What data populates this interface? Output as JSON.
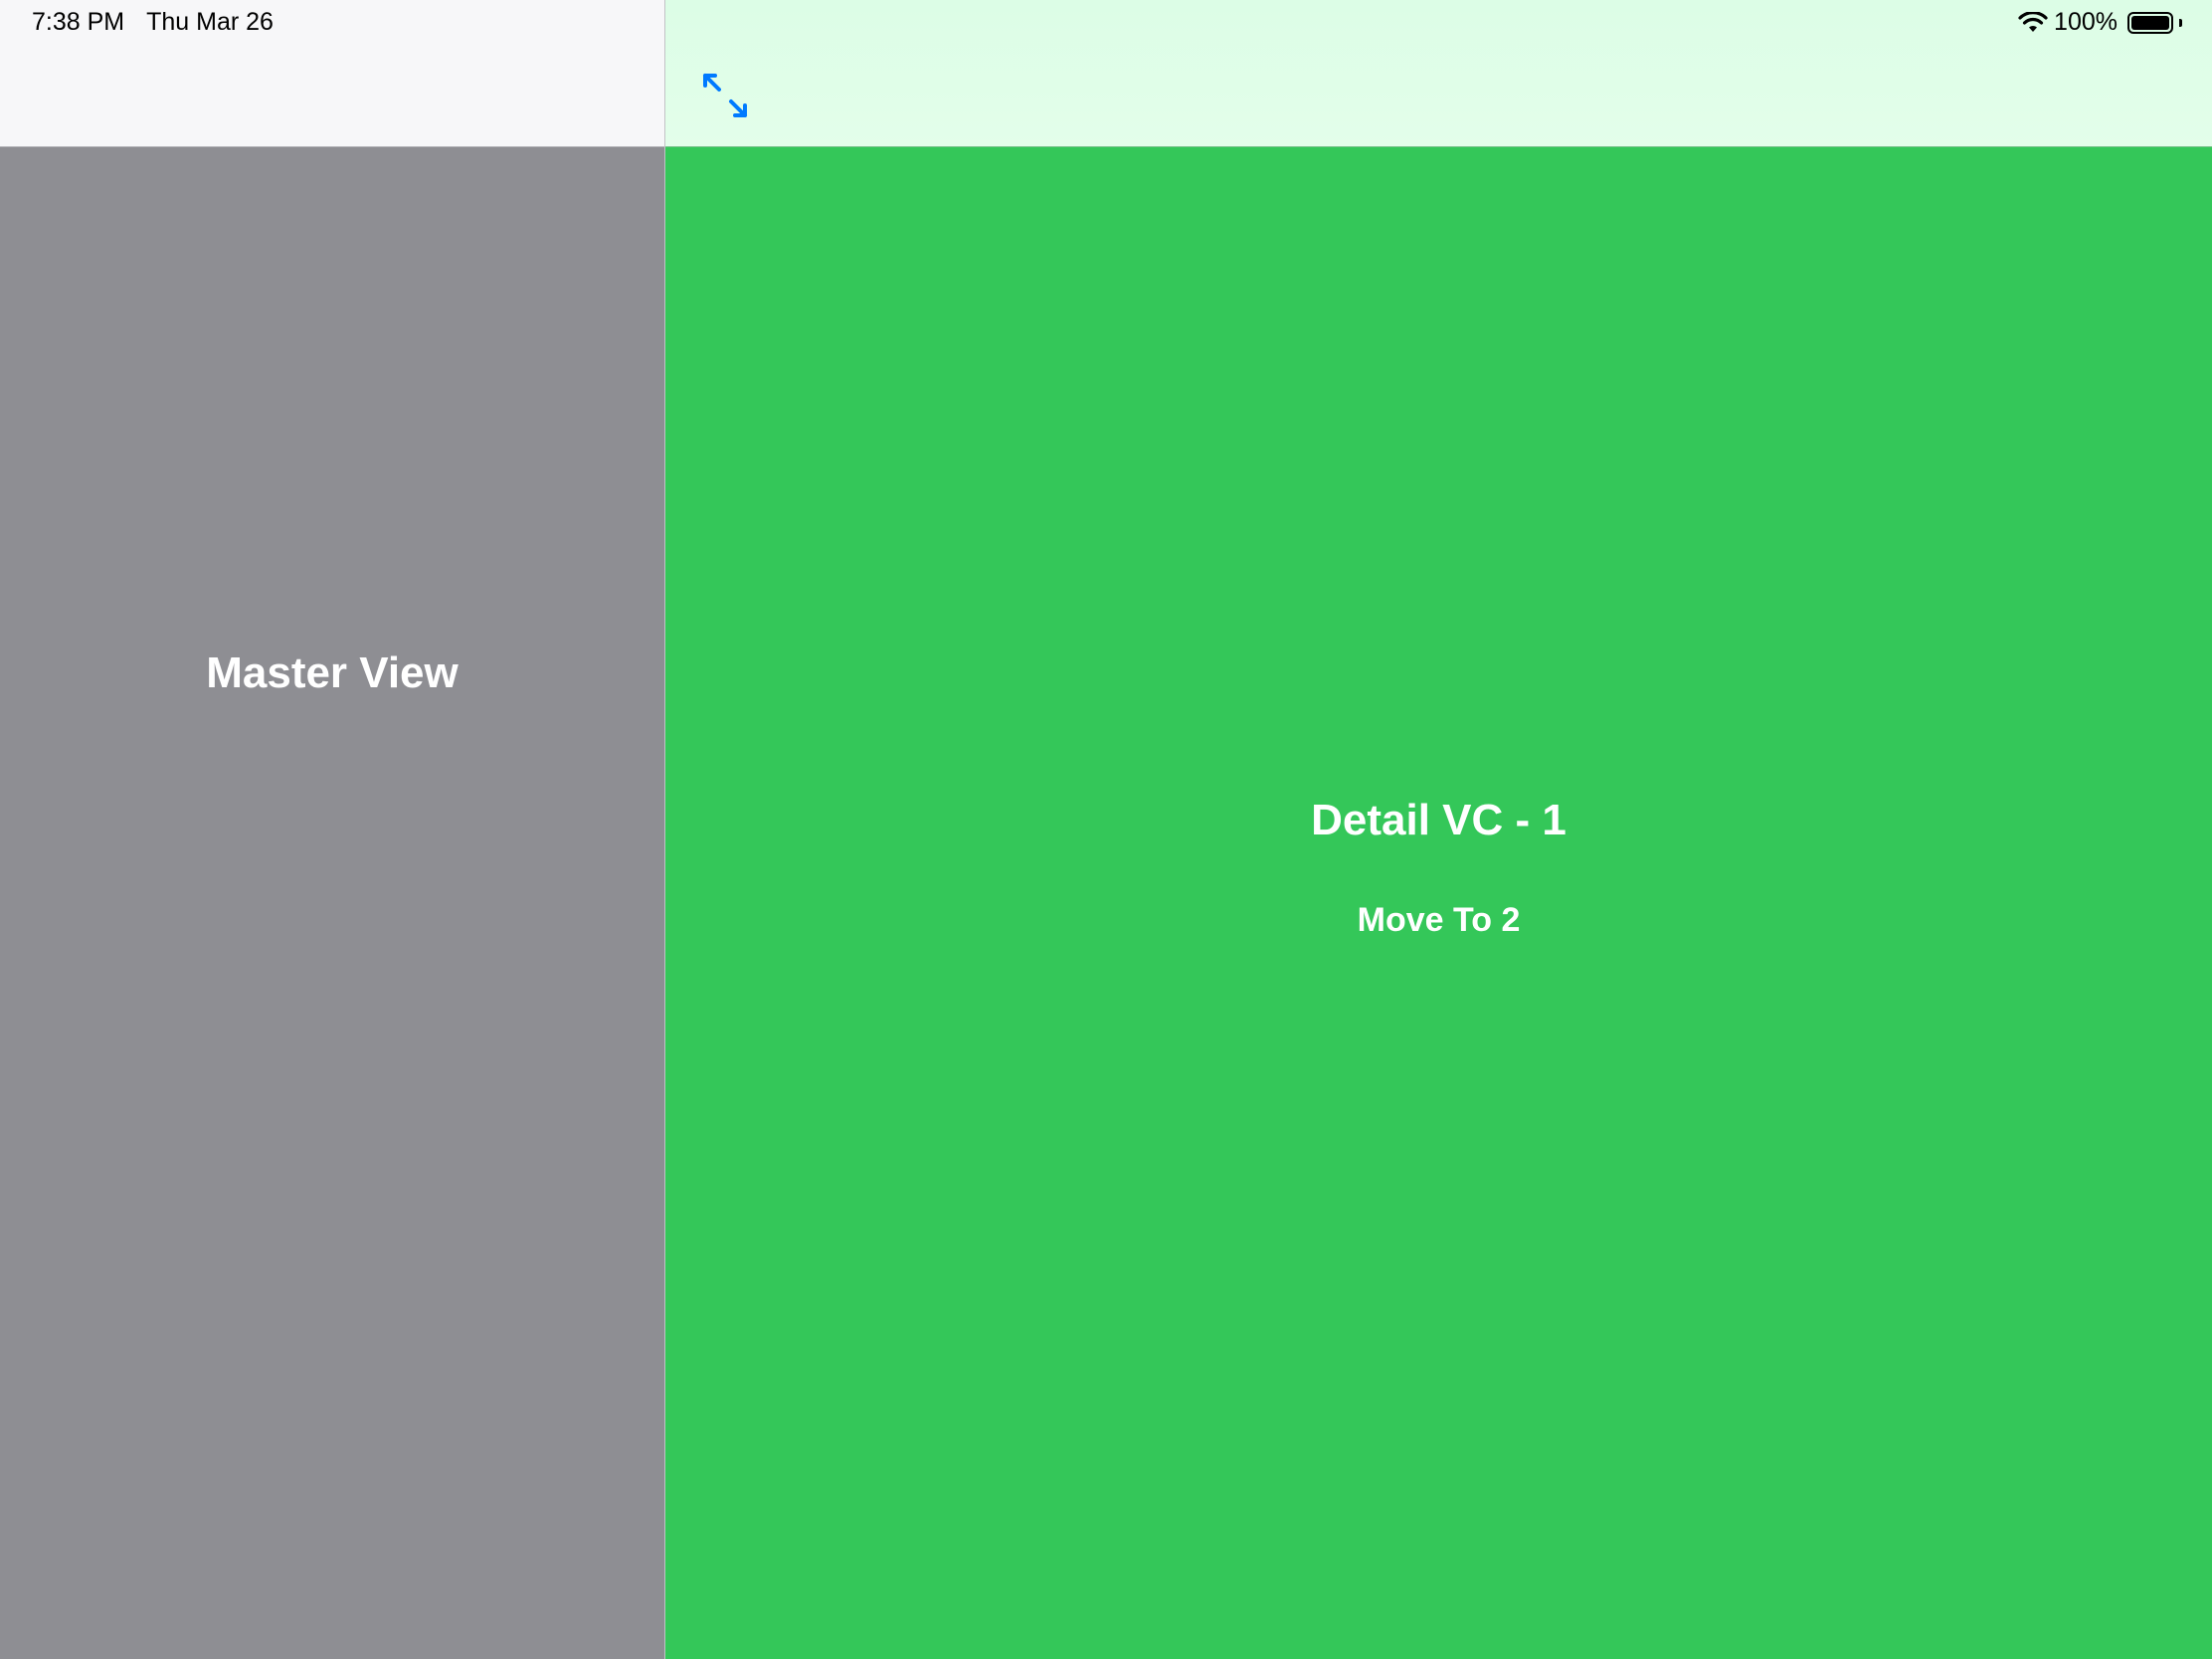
{
  "status_bar": {
    "time": "7:38 PM",
    "date": "Thu Mar 26",
    "battery_percent_label": "100%",
    "battery_level": 1.0,
    "wifi_icon": "wifi-icon"
  },
  "master": {
    "title": "Master View",
    "background": "#8e8e93"
  },
  "detail": {
    "title": "Detail VC - 1",
    "action_label": "Move To 2",
    "background": "#34c759",
    "expand_icon": "expand-arrows-icon",
    "accent": "#007aff"
  }
}
